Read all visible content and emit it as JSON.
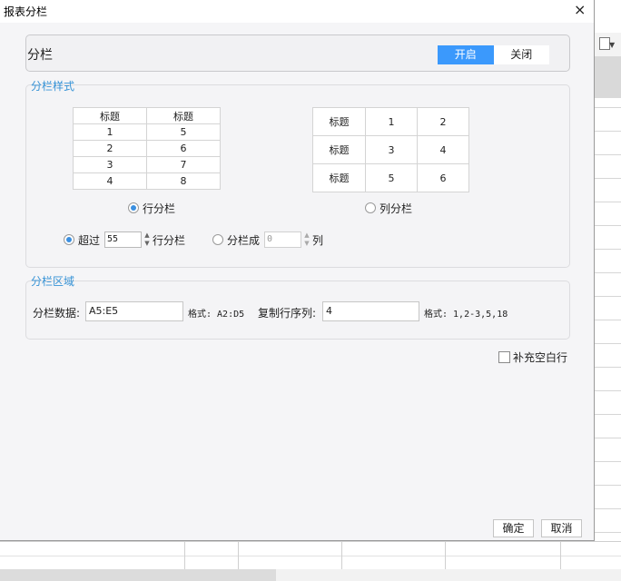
{
  "dialog": {
    "title": "报表分栏",
    "close_icon": "×"
  },
  "column_split": {
    "label": "分栏",
    "on_label": "开启",
    "off_label": "关闭",
    "active": "on"
  },
  "style_section": {
    "label": "分栏样式",
    "row_table": {
      "header": [
        "标题",
        "标题"
      ],
      "rows": [
        [
          "1",
          "5"
        ],
        [
          "2",
          "6"
        ],
        [
          "3",
          "7"
        ],
        [
          "4",
          "8"
        ]
      ]
    },
    "col_table": {
      "rows": [
        [
          "标题",
          "1",
          "2"
        ],
        [
          "标题",
          "3",
          "4"
        ],
        [
          "标题",
          "5",
          "6"
        ]
      ]
    },
    "row_mode_label": "行分栏",
    "col_mode_label": "列分栏",
    "exceed_label": "超过",
    "exceed_value": "55",
    "exceed_suffix": "行分栏",
    "split_into_label": "分栏成",
    "split_into_value": "0",
    "split_into_suffix": "列"
  },
  "area_section": {
    "label": "分栏区域",
    "data_label": "分栏数据:",
    "data_value": "A5:E5",
    "data_format": "格式: A2:D5",
    "copy_rows_label": "复制行序列:",
    "copy_rows_value": "4",
    "copy_rows_format": "格式: 1,2-3,5,18"
  },
  "fill_blank_label": "补充空白行",
  "buttons": {
    "ok": "确定",
    "cancel": "取消"
  }
}
